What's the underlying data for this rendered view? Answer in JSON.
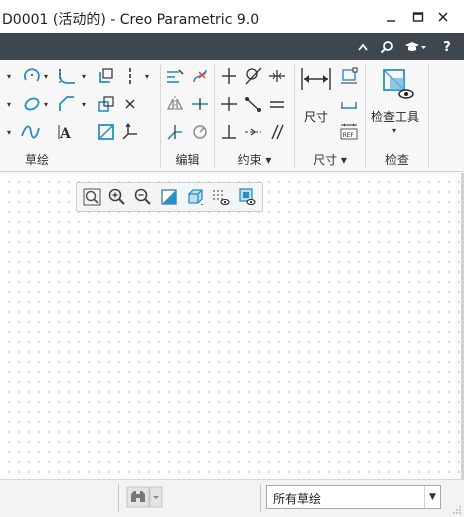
{
  "window": {
    "title": "D0001 (活动的) - Creo Parametric 9.0",
    "minimize_label": "—",
    "maximize_label": "☐",
    "close_label": "✕"
  },
  "topbar": {
    "collapse_label": "⌃",
    "search_label": "⌕",
    "help_label": "?"
  },
  "ribbon": {
    "groups": {
      "sketch": {
        "label": "草绘"
      },
      "edit": {
        "label": "编辑"
      },
      "constraint": {
        "label": "约束 ▾"
      },
      "dimension": {
        "label": "尺寸 ▾",
        "button_label": "尺寸"
      },
      "inspect": {
        "label": "检查",
        "button_label": "检查工具"
      }
    },
    "ref_label": "REF"
  },
  "graphics_toolbar": {
    "tools": [
      "refit-icon",
      "zoom-in-icon",
      "zoom-out-icon",
      "repaint-icon",
      "display-style-icon",
      "sketcher-display-icon",
      "saved-orientations-icon"
    ]
  },
  "statusbar": {
    "selection_filter": {
      "value": "所有草绘",
      "options_visible": [
        "所有草绘"
      ]
    }
  },
  "colors": {
    "accent_blue": "#2a8fc7",
    "dark_bar": "#3e474d",
    "title_bg": "#ffffff"
  }
}
